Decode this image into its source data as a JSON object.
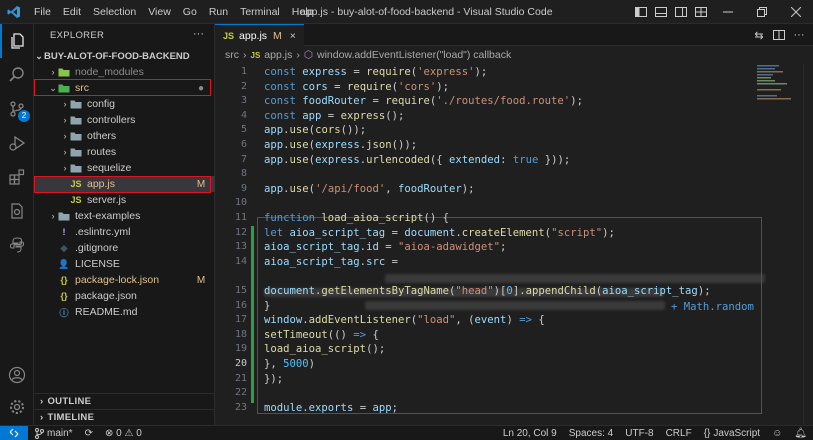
{
  "titlebar": {
    "menus": [
      "File",
      "Edit",
      "Selection",
      "View",
      "Go",
      "Run",
      "Terminal",
      "Help"
    ],
    "title": "app.js - buy-alot-of-food-backend - Visual Studio Code"
  },
  "activity_bar": {
    "scm_badge": "2"
  },
  "explorer": {
    "header": "EXPLORER",
    "more": "···",
    "root": "BUY-ALOT-OF-FOOD-BACKEND",
    "items": [
      {
        "label": "node_modules",
        "chevron": "›",
        "icon": "📁",
        "deco": ""
      },
      {
        "label": "src",
        "chevron": "⌄",
        "icon": "📁",
        "deco": "●"
      },
      {
        "label": "config",
        "chevron": "›",
        "icon": "📁",
        "deco": ""
      },
      {
        "label": "controllers",
        "chevron": "›",
        "icon": "📁",
        "deco": ""
      },
      {
        "label": "others",
        "chevron": "›",
        "icon": "📁",
        "deco": ""
      },
      {
        "label": "routes",
        "chevron": "›",
        "icon": "📁",
        "deco": ""
      },
      {
        "label": "sequelize",
        "chevron": "›",
        "icon": "📁",
        "deco": ""
      },
      {
        "label": "app.js",
        "chevron": "",
        "icon": "JS",
        "deco": "M"
      },
      {
        "label": "server.js",
        "chevron": "",
        "icon": "JS",
        "deco": ""
      },
      {
        "label": "text-examples",
        "chevron": "›",
        "icon": "📁",
        "deco": ""
      },
      {
        "label": ".eslintrc.yml",
        "chevron": "",
        "icon": "!",
        "deco": ""
      },
      {
        "label": ".gitignore",
        "chevron": "",
        "icon": "◆",
        "deco": ""
      },
      {
        "label": "LICENSE",
        "chevron": "",
        "icon": "👤",
        "deco": ""
      },
      {
        "label": "package-lock.json",
        "chevron": "",
        "icon": "{}",
        "deco": "M"
      },
      {
        "label": "package.json",
        "chevron": "",
        "icon": "{}",
        "deco": ""
      },
      {
        "label": "README.md",
        "chevron": "",
        "icon": "ⓘ",
        "deco": ""
      }
    ],
    "outline": "OUTLINE",
    "timeline": "TIMELINE"
  },
  "editor": {
    "tab": {
      "label": "app.js",
      "modified": "M",
      "close": "×"
    },
    "breadcrumbs": [
      "src",
      "›",
      "app.js",
      "›",
      "window.addEventListener(\"load\") callback"
    ],
    "line_numbers": [
      "1",
      "2",
      "3",
      "4",
      "5",
      "6",
      "7",
      "8",
      "9",
      "10",
      "11",
      "12",
      "13",
      "14",
      "",
      "15",
      "16",
      "17",
      "18",
      "19",
      "20",
      "21",
      "22",
      "23"
    ],
    "current_line": "20",
    "lines": [
      [
        [
          "k",
          "const "
        ],
        [
          "v",
          "express"
        ],
        [
          "p",
          " = "
        ],
        [
          "f",
          "require"
        ],
        [
          "p",
          "("
        ],
        [
          "s",
          "'express'"
        ],
        [
          "p",
          ");"
        ]
      ],
      [
        [
          "k",
          "const "
        ],
        [
          "v",
          "cors"
        ],
        [
          "p",
          " = "
        ],
        [
          "f",
          "require"
        ],
        [
          "p",
          "("
        ],
        [
          "s",
          "'cors'"
        ],
        [
          "p",
          ");"
        ]
      ],
      [
        [
          "k",
          "const "
        ],
        [
          "v",
          "foodRouter"
        ],
        [
          "p",
          " = "
        ],
        [
          "f",
          "require"
        ],
        [
          "p",
          "("
        ],
        [
          "s",
          "'./routes/food.route'"
        ],
        [
          "p",
          ");"
        ]
      ],
      [
        [
          "k",
          "const "
        ],
        [
          "v",
          "app"
        ],
        [
          "p",
          " = "
        ],
        [
          "f",
          "express"
        ],
        [
          "p",
          "();"
        ]
      ],
      [
        [
          "v",
          "app"
        ],
        [
          "p",
          "."
        ],
        [
          "f",
          "use"
        ],
        [
          "p",
          "("
        ],
        [
          "f",
          "cors"
        ],
        [
          "p",
          "());"
        ]
      ],
      [
        [
          "v",
          "app"
        ],
        [
          "p",
          "."
        ],
        [
          "f",
          "use"
        ],
        [
          "p",
          "("
        ],
        [
          "v",
          "express"
        ],
        [
          "p",
          "."
        ],
        [
          "f",
          "json"
        ],
        [
          "p",
          "());"
        ]
      ],
      [
        [
          "v",
          "app"
        ],
        [
          "p",
          "."
        ],
        [
          "f",
          "use"
        ],
        [
          "p",
          "("
        ],
        [
          "v",
          "express"
        ],
        [
          "p",
          "."
        ],
        [
          "f",
          "urlencoded"
        ],
        [
          "p",
          "({ "
        ],
        [
          "v",
          "extended"
        ],
        [
          "p",
          ": "
        ],
        [
          "k",
          "true"
        ],
        [
          "p",
          " }));"
        ]
      ],
      [],
      [
        [
          "v",
          "app"
        ],
        [
          "p",
          "."
        ],
        [
          "f",
          "use"
        ],
        [
          "p",
          "("
        ],
        [
          "s",
          "'/api/food'"
        ],
        [
          "p",
          ", "
        ],
        [
          "v",
          "foodRouter"
        ],
        [
          "p",
          ");"
        ]
      ],
      [],
      [
        [
          "k",
          "function "
        ],
        [
          "f",
          "load_aioa_script"
        ],
        [
          "p",
          "() {"
        ]
      ],
      [
        [
          "k",
          "let "
        ],
        [
          "v",
          "aioa_script_tag"
        ],
        [
          "p",
          " = "
        ],
        [
          "v",
          "document"
        ],
        [
          "p",
          "."
        ],
        [
          "f",
          "createElement"
        ],
        [
          "p",
          "("
        ],
        [
          "s",
          "\"script\""
        ],
        [
          "p",
          ");"
        ]
      ],
      [
        [
          "v",
          "aioa_script_tag"
        ],
        [
          "p",
          "."
        ],
        [
          "v",
          "id"
        ],
        [
          "p",
          " = "
        ],
        [
          "s",
          "\"aioa-adawidget\""
        ],
        [
          "p",
          ";"
        ]
      ],
      [
        [
          "v",
          "aioa_script_tag"
        ],
        [
          "p",
          "."
        ],
        [
          "v",
          "src"
        ],
        [
          "p",
          " = "
        ]
      ],
      [],
      [
        [
          "v",
          "document"
        ],
        [
          "p",
          "."
        ],
        [
          "f",
          "getElementsByTagName"
        ],
        [
          "p",
          "("
        ],
        [
          "s",
          "\"head\""
        ],
        [
          "p",
          ")["
        ],
        [
          "c",
          "0"
        ],
        [
          "p",
          "]."
        ],
        [
          "f",
          "appendChild"
        ],
        [
          "p",
          "("
        ],
        [
          "v",
          "aioa_script_tag"
        ],
        [
          "p",
          ");"
        ]
      ],
      [
        [
          "p",
          "}"
        ]
      ],
      [
        [
          "v",
          "window"
        ],
        [
          "p",
          "."
        ],
        [
          "f",
          "addEventListener"
        ],
        [
          "p",
          "("
        ],
        [
          "s",
          "\"load\""
        ],
        [
          "p",
          ", ("
        ],
        [
          "v",
          "event"
        ],
        [
          "p",
          ") "
        ],
        [
          "k",
          "=>"
        ],
        [
          "p",
          " {"
        ]
      ],
      [
        [
          "f",
          "setTimeout"
        ],
        [
          "p",
          "(() "
        ],
        [
          "k",
          "=>"
        ],
        [
          "p",
          " {"
        ]
      ],
      [
        [
          "f",
          "load_aioa_script"
        ],
        [
          "p",
          "();"
        ]
      ],
      [
        [
          "p",
          "}, "
        ],
        [
          "c",
          "5000"
        ],
        [
          "p",
          ")"
        ]
      ],
      [
        [
          "p",
          "});"
        ]
      ],
      [],
      [
        [
          "v",
          "module"
        ],
        [
          "p",
          "."
        ],
        [
          "v",
          "exports"
        ],
        [
          "p",
          " = "
        ],
        [
          "v",
          "app"
        ],
        [
          "p",
          ";"
        ]
      ]
    ],
    "math_random": "+ Math.random"
  },
  "statusbar": {
    "branch": "main*",
    "problems": "⊗ 0 ⚠ 0",
    "position": "Ln 20, Col 9",
    "spaces": "Spaces: 4",
    "encoding": "UTF-8",
    "eol": "CRLF",
    "language": "JavaScript",
    "language_braces": "{}"
  },
  "colors": {
    "accent": "#0078d4",
    "highlight_box": "#e0141e",
    "modified": "#e2c08d",
    "added_gutter": "#2ea043"
  }
}
